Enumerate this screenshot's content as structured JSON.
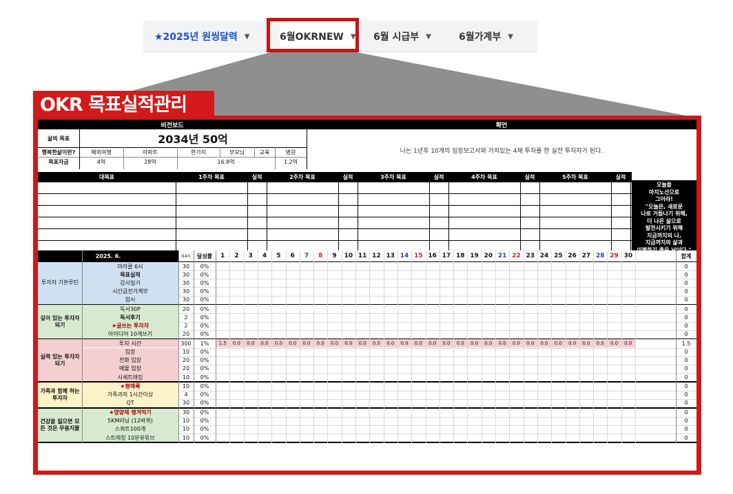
{
  "tabs": [
    {
      "label": "★2025년 원씽달력"
    },
    {
      "label": "6월OKRNEW"
    },
    {
      "label": "6월 시급부"
    },
    {
      "label": "6월가계부"
    }
  ],
  "title": "OKR 목표실적관리",
  "vision": {
    "header_left": "비전보드",
    "header_right": "확언",
    "life_goal_label": "삶의 목표",
    "life_goal_value": "2034년 50억",
    "happy_label": "행복한삶이란?",
    "fund_label": "목표자금",
    "items": [
      {
        "label": "해외여행",
        "value": "4억"
      },
      {
        "label": "아파트",
        "value": "28억"
      },
      {
        "label": "한가지",
        "value": ""
      },
      {
        "label": "부모님",
        "value": ""
      },
      {
        "label": "교육",
        "value": ""
      },
      {
        "label": "병원",
        "value": "1.2억"
      }
    ],
    "merged_value": "16.8억",
    "affirmation": "나는 1년후 10개의 임장보고서와 가치있는 4채 투자를 한 실전 투자자가 된다."
  },
  "goals_header": {
    "main": "대목표",
    "weeks": [
      "1주차 목표",
      "2주차 목표",
      "3주차 목표",
      "4주차 목표",
      "5주차 목표"
    ],
    "result": "실적"
  },
  "motto": [
    "오늘을",
    "마지노선으로",
    "그어라!",
    "\"오늘은, 새로운",
    "나로 거듭나기 위해,",
    "더 나은 삶으로",
    "발전시키기 위해",
    "지금까지의 나,",
    "지금까지의 삶과",
    "이별하기 좋은 날이다.\""
  ],
  "tracker": {
    "month": "2025. 6.",
    "col_target": "목표치",
    "col_rate": "달성률",
    "col_total": "합계",
    "days": [
      "1",
      "2",
      "3",
      "4",
      "5",
      "6",
      "7",
      "8",
      "9",
      "10",
      "11",
      "12",
      "13",
      "14",
      "15",
      "16",
      "17",
      "18",
      "19",
      "20",
      "21",
      "22",
      "23",
      "24",
      "25",
      "26",
      "27",
      "28",
      "29",
      "30"
    ],
    "day_colors": {
      "7": "#1a3fd6",
      "8": "#d21b1b",
      "14": "#1a3fd6",
      "15": "#d21b1b",
      "21": "#1a3fd6",
      "22": "#d21b1b",
      "28": "#1a3fd6",
      "29": "#d21b1b"
    },
    "groups": [
      {
        "name": "투자자 기본루틴",
        "color": "#cfe0f3",
        "rows": [
          {
            "label": "미라클 6시",
            "target": "30",
            "rate": "0%",
            "total": "0"
          },
          {
            "label": "목표실적",
            "target": "30",
            "rate": "0%",
            "total": "0",
            "bold": true
          },
          {
            "label": "감사일기",
            "target": "30",
            "rate": "0%",
            "total": "0"
          },
          {
            "label": "시간급전가계부",
            "target": "30",
            "rate": "0%",
            "total": "0"
          },
          {
            "label": "암시",
            "target": "30",
            "rate": "0%",
            "total": "0"
          }
        ]
      },
      {
        "name": "깊이 있는 투자자되기",
        "color": "#d6ead0",
        "rows": [
          {
            "label": "독서30P",
            "target": "20",
            "rate": "0%",
            "total": "0"
          },
          {
            "label": "독서후기",
            "target": "2",
            "rate": "0%",
            "total": "0",
            "bold": true
          },
          {
            "label": "★글쓰는 투자자",
            "target": "2",
            "rate": "0%",
            "total": "0",
            "bold": true,
            "red": true
          },
          {
            "label": "아이디어 10개쓰기",
            "target": "20",
            "rate": "0%",
            "total": "0"
          }
        ]
      },
      {
        "name": "실력 있는 투자자 되기",
        "color": "#f4cfd0",
        "rows": [
          {
            "label": "투자 시간",
            "target": "300",
            "rate": "1%",
            "total": "1.5",
            "daily": [
              "1.5",
              "0.0",
              "0.0",
              "0.0",
              "0.0",
              "0.0",
              "0.0",
              "0.0",
              "0.0",
              "0.0",
              "0.0",
              "0.0",
              "0.0",
              "0.0",
              "0.0",
              "0.0",
              "0.0",
              "0.0",
              "0.0",
              "0.0",
              "0.0",
              "0.0",
              "0.0",
              "0.0",
              "0.0",
              "0.0",
              "0.0",
              "0.0",
              "0.0",
              "0.0"
            ]
          },
          {
            "label": "임장",
            "target": "10",
            "rate": "0%",
            "total": "0"
          },
          {
            "label": "전화 임장",
            "target": "20",
            "rate": "0%",
            "total": "0"
          },
          {
            "label": "매물 임장",
            "target": "20",
            "rate": "0%",
            "total": "0"
          },
          {
            "label": "시세트래킹",
            "target": "10",
            "rate": "0%",
            "total": "0"
          }
        ]
      },
      {
        "name": "가족과 함께 하는 투자자",
        "color": "#fbf2c8",
        "rows": [
          {
            "label": "★평매록",
            "target": "10",
            "rate": "0%",
            "total": "0",
            "bold": true,
            "red": true
          },
          {
            "label": "가족과의 1시간이상",
            "target": "4",
            "rate": "0%",
            "total": "0"
          },
          {
            "label": "QT",
            "target": "30",
            "rate": "0%",
            "total": "0"
          }
        ]
      },
      {
        "name": "건강을 잃으면 모든 것은 무용지물",
        "color": "#d6ead0",
        "rows": [
          {
            "label": "★영양제 챙겨먹기",
            "target": "30",
            "rate": "0%",
            "total": "0",
            "bold": true,
            "red": true
          },
          {
            "label": "5KM러닝 (12바퀴)",
            "target": "10",
            "rate": "0%",
            "total": "0"
          },
          {
            "label": "스쿼트100개",
            "target": "10",
            "rate": "0%",
            "total": "0"
          },
          {
            "label": "스트레칭 10분유튜브",
            "target": "10",
            "rate": "0%",
            "total": "0"
          }
        ]
      }
    ]
  },
  "colors": {
    "accent": "#cc1a1a",
    "tab_blue": "#1a4fd6",
    "header": "#000000"
  }
}
